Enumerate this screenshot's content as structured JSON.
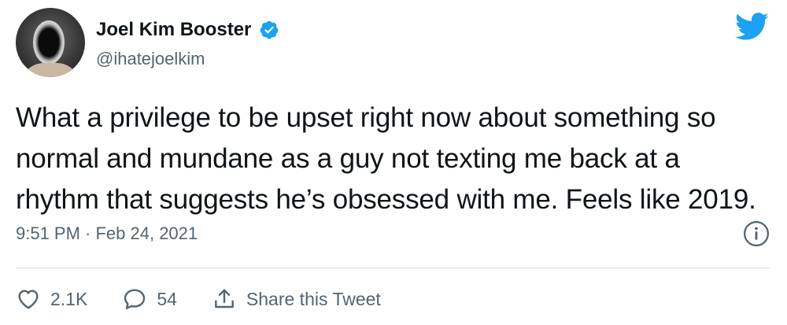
{
  "author": {
    "name": "Joel Kim Booster",
    "handle": "@ihatejoelkim",
    "verified": true
  },
  "tweet": {
    "lines": [
      "What a privilege to be upset right now about something so",
      "normal and mundane as a guy not texting me back at a",
      "rhythm that suggests he’s obsessed with me. Feels like 2019."
    ],
    "timestamp": "9:51 PM · Feb 24, 2021"
  },
  "actions": {
    "likes": "2.1K",
    "replies": "54",
    "share_label": "Share this Tweet"
  },
  "icons": {
    "brand": "twitter-bird-icon",
    "verified": "verified-badge-icon",
    "info": "info-icon",
    "like": "heart-icon",
    "reply": "reply-bubble-icon",
    "share": "share-icon"
  },
  "colors": {
    "brand": "#1da1f2",
    "text": "#0f1419",
    "secondary": "#536471",
    "divider": "#cfd9de"
  }
}
